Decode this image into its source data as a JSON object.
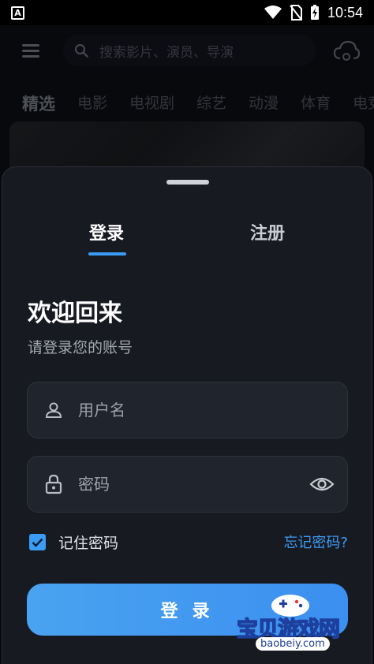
{
  "status_bar": {
    "app_icon_letter": "A",
    "time": "10:54"
  },
  "background": {
    "search": {
      "placeholder": "搜索影片、演员、导演"
    },
    "categories": [
      "精选",
      "电影",
      "电视剧",
      "综艺",
      "动漫",
      "体育",
      "电竞"
    ]
  },
  "sheet": {
    "tabs": {
      "login": "登录",
      "register": "注册"
    },
    "welcome_title": "欢迎回来",
    "welcome_subtitle": "请登录您的账号",
    "username": {
      "placeholder": "用户名",
      "value": ""
    },
    "password": {
      "placeholder": "密码",
      "value": ""
    },
    "remember_label": "记住密码",
    "remember_checked": true,
    "forgot_label": "忘记密码?",
    "login_button": "登 录"
  },
  "watermark": {
    "text": "宝贝游戏网",
    "url": "baobeiy.com"
  },
  "colors": {
    "accent": "#3b9cf5",
    "sheet_bg": "#171a21",
    "field_bg": "#20242c"
  }
}
